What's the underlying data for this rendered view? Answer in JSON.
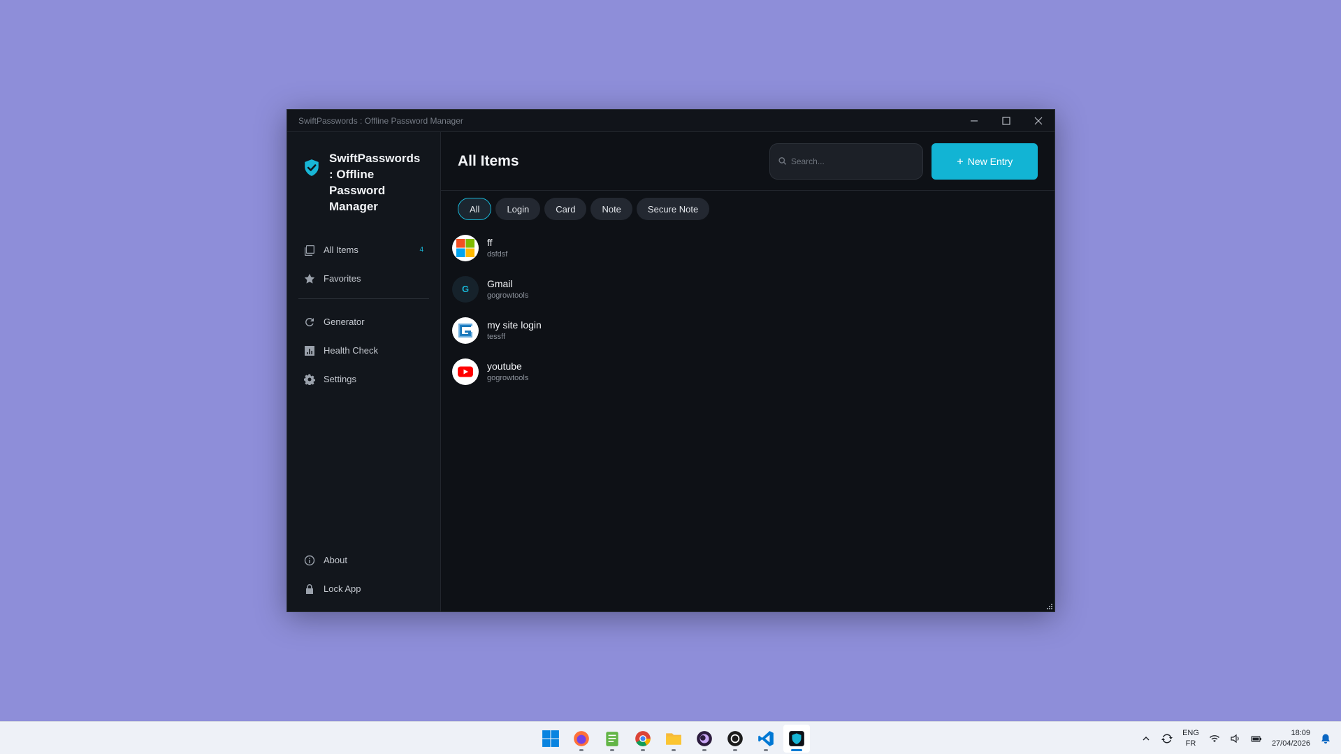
{
  "window": {
    "title": "SwiftPasswords : Offline Password Manager"
  },
  "sidebar": {
    "brand_title": "SwiftPasswords : Offline Password Manager",
    "items": [
      {
        "label": "All Items",
        "badge": "4",
        "icon": "stack-icon"
      },
      {
        "label": "Favorites",
        "icon": "star-icon"
      },
      {
        "label": "Generator",
        "icon": "refresh-icon"
      },
      {
        "label": "Health Check",
        "icon": "chart-icon"
      },
      {
        "label": "Settings",
        "icon": "gear-icon"
      }
    ],
    "bottom": [
      {
        "label": "About",
        "icon": "info-icon"
      },
      {
        "label": "Lock App",
        "icon": "lock-icon"
      }
    ]
  },
  "main": {
    "title": "All Items",
    "search_placeholder": "Search...",
    "new_entry_label": "New Entry",
    "filters": [
      "All",
      "Login",
      "Card",
      "Note",
      "Secure Note"
    ],
    "active_filter": "All",
    "entries": [
      {
        "title": "ff",
        "subtitle": "dsfdsf",
        "icon": "microsoft-logo-icon"
      },
      {
        "title": "Gmail",
        "subtitle": "gogrowtools",
        "icon": "letter-g-icon",
        "letter": "G"
      },
      {
        "title": "my site login",
        "subtitle": "tessff",
        "icon": "g-logo-icon"
      },
      {
        "title": "youtube",
        "subtitle": "gogrowtools",
        "icon": "youtube-logo-icon"
      }
    ]
  },
  "taskbar": {
    "lang_primary": "ENG",
    "lang_secondary": "FR",
    "time": "18:09",
    "date": "27/04/2026"
  },
  "colors": {
    "accent": "#12b4d4",
    "desktop": "#8e8ed9",
    "window_bg": "#0e1116",
    "sidebar_bg": "#12161c"
  }
}
